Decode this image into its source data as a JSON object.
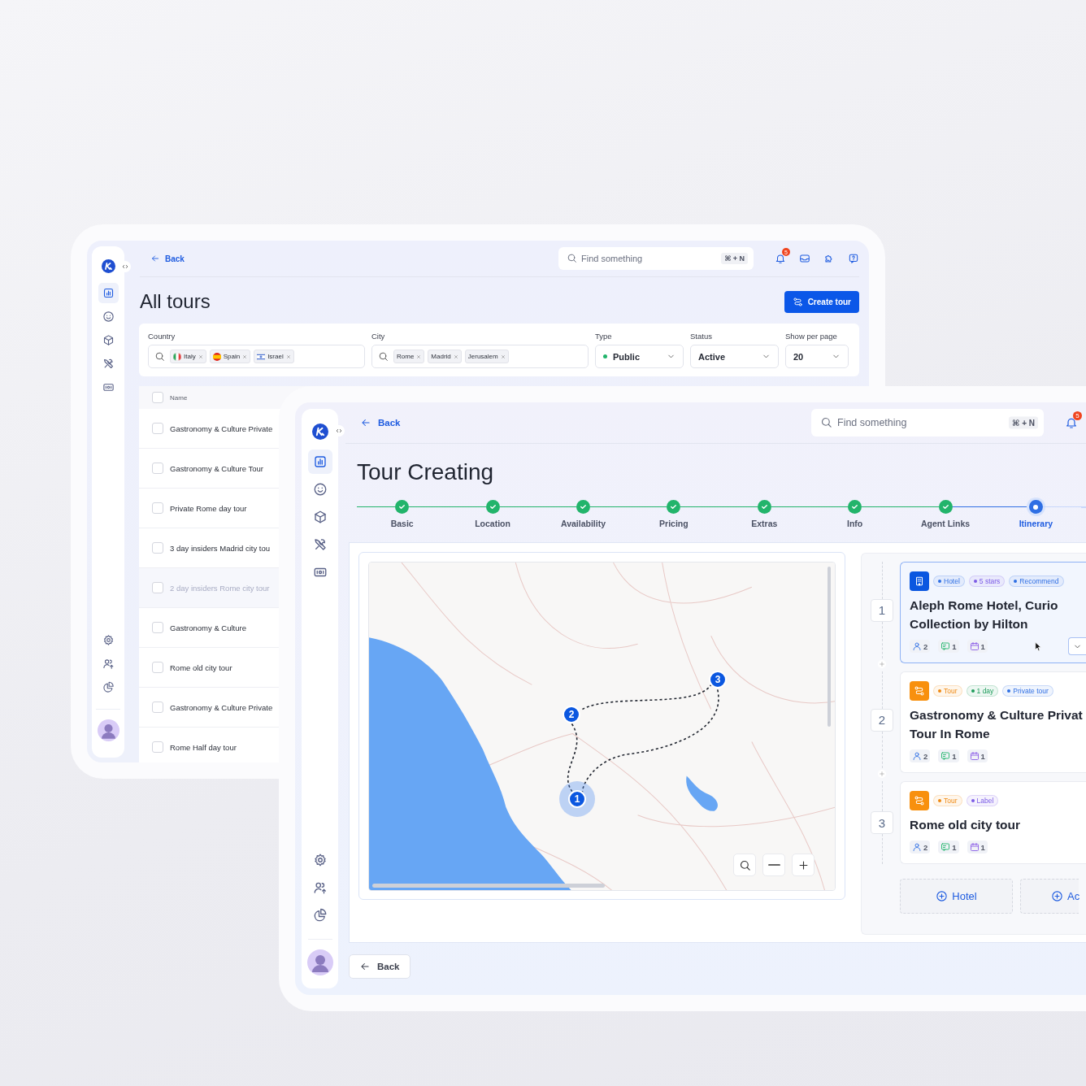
{
  "tours_window": {
    "sidebar": {
      "items": [
        {
          "kind": "chart",
          "selected": true
        },
        {
          "kind": "smile",
          "selected": false
        },
        {
          "kind": "cube",
          "selected": false
        },
        {
          "kind": "tools",
          "selected": false
        },
        {
          "kind": "ticket",
          "selected": false
        }
      ],
      "bottom_items": [
        {
          "kind": "gear"
        },
        {
          "kind": "users"
        },
        {
          "kind": "pie"
        }
      ]
    },
    "header": {
      "back": "Back",
      "search_placeholder": "Find something",
      "shortcut": "⌘ + N",
      "tools": [
        {
          "kind": "bell",
          "badge": "5"
        },
        {
          "kind": "inbox"
        },
        {
          "kind": "puzzle"
        },
        {
          "kind": "help"
        }
      ]
    },
    "title": "All tours",
    "create_button": "Create tour",
    "filters": {
      "country": {
        "label": "Country",
        "chips": [
          {
            "kind": "italy",
            "text": "Italy"
          },
          {
            "kind": "spain",
            "text": "Spain"
          },
          {
            "kind": "israel",
            "text": "Israel"
          }
        ]
      },
      "city": {
        "label": "City",
        "chips": [
          "Rome",
          "Madrid",
          "Jerusalem"
        ]
      },
      "type": {
        "label": "Type",
        "value": "Public"
      },
      "status": {
        "label": "Status",
        "value": "Active"
      },
      "per_page": {
        "label": "Show per page",
        "value": "20"
      }
    },
    "table": {
      "column": "Name",
      "header_checked": false,
      "rows": [
        {
          "name": "Gastronomy & Culture Private",
          "checked": false,
          "disabled": false
        },
        {
          "name": "Gastronomy & Culture Tour",
          "checked": false,
          "disabled": false
        },
        {
          "name": "Private Rome day tour",
          "checked": false,
          "disabled": false
        },
        {
          "name": "3 day insiders Madrid city tou",
          "checked": false,
          "disabled": false
        },
        {
          "name": "2 day insiders Rome city tour",
          "checked": false,
          "disabled": true
        },
        {
          "name": "Gastronomy & Culture",
          "checked": false,
          "disabled": false
        },
        {
          "name": "Rome old city tour",
          "checked": false,
          "disabled": false
        },
        {
          "name": "Gastronomy & Culture Private",
          "checked": false,
          "disabled": false
        },
        {
          "name": "Rome Half day tour",
          "checked": false,
          "disabled": false
        }
      ]
    }
  },
  "tour_window": {
    "sidebar": {
      "items": [
        {
          "kind": "chart",
          "selected": true
        },
        {
          "kind": "smile",
          "selected": false
        },
        {
          "kind": "cube",
          "selected": false
        },
        {
          "kind": "tools",
          "selected": false
        },
        {
          "kind": "ticket",
          "selected": false
        }
      ],
      "bottom_items": [
        {
          "kind": "gear"
        },
        {
          "kind": "users"
        },
        {
          "kind": "pie"
        }
      ]
    },
    "header": {
      "back": "Back",
      "search_placeholder": "Find something",
      "shortcut": "⌘ + N",
      "tools": [
        {
          "kind": "bell",
          "badge": "5"
        }
      ]
    },
    "title": "Tour Creating",
    "steps": [
      {
        "label": "Basic",
        "done": true,
        "selected": false
      },
      {
        "label": "Location",
        "done": true,
        "selected": false
      },
      {
        "label": "Availability",
        "done": true,
        "selected": false
      },
      {
        "label": "Pricing",
        "done": true,
        "selected": false
      },
      {
        "label": "Extras",
        "done": true,
        "selected": false
      },
      {
        "label": "Info",
        "done": true,
        "selected": false
      },
      {
        "label": "Agent Links",
        "done": true,
        "selected": false
      },
      {
        "label": "Itinerary",
        "done": false,
        "selected": true
      }
    ],
    "map": {
      "pins": [
        {
          "label": "1",
          "active": true
        },
        {
          "label": "2",
          "active": false
        },
        {
          "label": "3",
          "active": false
        }
      ]
    },
    "itinerary": {
      "stops": [
        {
          "number": "1",
          "kind": "hotel",
          "selected": true,
          "tags": [
            {
              "text": "Hotel",
              "color": "#2f6fe4"
            },
            {
              "text": "5 stars",
              "color": "#7c5ce6"
            },
            {
              "text": "Recommend",
              "color": "#2f6fe4"
            }
          ],
          "title": "Aleph Rome Hotel, Curio Collection by Hilton",
          "meta": [
            {
              "kind": "guests",
              "text": "2"
            },
            {
              "kind": "comments",
              "text": "1"
            },
            {
              "kind": "dates",
              "text": "1"
            }
          ]
        },
        {
          "number": "2",
          "kind": "tour",
          "selected": false,
          "tags": [
            {
              "text": "Tour",
              "color": "#f08a12"
            },
            {
              "text": "1 day",
              "color": "#1f9d5c"
            },
            {
              "text": "Private tour",
              "color": "#2f6fe4"
            }
          ],
          "title": "Gastronomy & Culture Privat Tour In Rome",
          "meta": [
            {
              "kind": "guests",
              "text": "2"
            },
            {
              "kind": "comments",
              "text": "1"
            },
            {
              "kind": "dates",
              "text": "1"
            }
          ]
        },
        {
          "number": "3",
          "kind": "tour",
          "selected": false,
          "tags": [
            {
              "text": "Tour",
              "color": "#f08a12"
            },
            {
              "text": "Label",
              "color": "#7c5ce6"
            }
          ],
          "title": "Rome old city tour",
          "meta": [
            {
              "kind": "guests",
              "text": "2"
            },
            {
              "kind": "comments",
              "text": "1"
            },
            {
              "kind": "dates",
              "text": "1"
            }
          ]
        }
      ],
      "add_buttons": [
        "Hotel",
        "Ac"
      ]
    },
    "footer": {
      "back": "Back"
    }
  }
}
